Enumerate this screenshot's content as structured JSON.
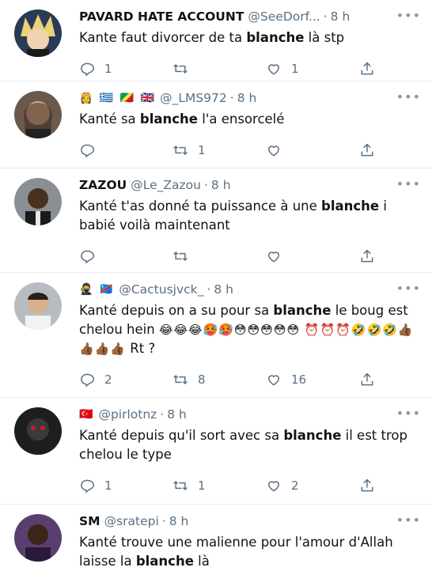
{
  "tweets": [
    {
      "name": "PAVARD HATE ACCOUNT",
      "handle": "@SeeDorf...",
      "time": "8 h",
      "pre": "Kante faut divorcer de ta ",
      "bold": "blanche",
      "post": " là stp",
      "extra": "",
      "reply": "1",
      "retweet": "",
      "like": "1"
    },
    {
      "name": "",
      "flags": "👸 🇬🇷 🇨🇬 🇬🇧",
      "handle": "@_LMS972",
      "time": "8 h",
      "pre": "Kanté sa ",
      "bold": "blanche",
      "post": " l'a ensorcelé",
      "extra": "",
      "reply": "",
      "retweet": "1",
      "like": ""
    },
    {
      "name": "ZAZOU",
      "handle": "@Le_Zazou",
      "time": "8 h",
      "pre": "Kanté t'as donné ta puissance à une ",
      "bold": "blanche",
      "post": " i babié voilà maintenant",
      "extra": "",
      "reply": "",
      "retweet": "",
      "like": ""
    },
    {
      "name": "",
      "flags": "🥷 🇨🇩",
      "handle": "@Cactusjvck_",
      "time": "8 h",
      "pre": "Kanté depuis on a su pour sa ",
      "bold": "blanche",
      "post": " le boug est chelou hein ",
      "extra": "😂😂😂🥵🥵😳😳😳😳😳 ⏰⏰⏰🤣🤣🤣👍🏾👍🏾👍🏾👍🏾",
      "post2": " Rt ?",
      "reply": "2",
      "retweet": "8",
      "like": "16"
    },
    {
      "name": "",
      "flags": "🇹🇷",
      "handle": "@pirlotnz",
      "time": "8 h",
      "pre": "Kanté depuis qu'il sort avec sa ",
      "bold": "blanche",
      "post": " il est trop chelou le type",
      "extra": "",
      "reply": "1",
      "retweet": "1",
      "like": "2"
    },
    {
      "name": "SM",
      "handle": "@sratepi",
      "time": "8 h",
      "pre": "Kanté trouve une malienne pour l'amour d'Allah laisse la ",
      "bold": "blanche",
      "post": " là",
      "extra": "",
      "reply": "",
      "retweet": "",
      "like": ""
    }
  ],
  "more_label": "•••",
  "colors": {
    "meta": "#5b7083",
    "text": "#0f1419",
    "divider": "#e6ecf0"
  },
  "icons": [
    "reply-icon",
    "retweet-icon",
    "like-icon",
    "share-icon",
    "more-icon"
  ]
}
